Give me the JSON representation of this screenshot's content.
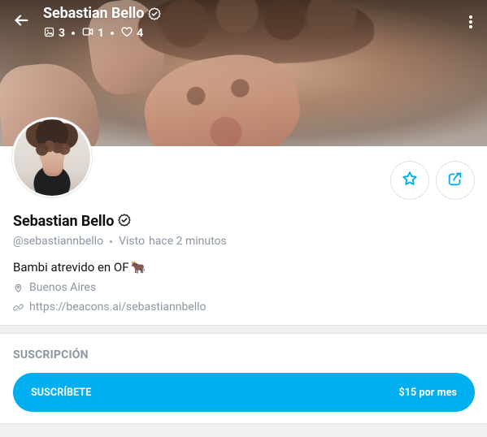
{
  "header": {
    "name": "Sebastian Bello",
    "stats": {
      "photos": "3",
      "videos": "1",
      "likes": "4"
    }
  },
  "profile": {
    "name": "Sebastian Bello",
    "username": "@sebastiannbello",
    "last_seen_label": "Visto",
    "last_seen_time": "hace 2 minutos",
    "bio": "Bambi atrevido en OF",
    "bio_emoji": "🐂",
    "location": "Buenos Aires",
    "website": "https://beacons.ai/sebastiannbello"
  },
  "subscription": {
    "title": "SUSCRIPCIÓN",
    "button_label": "SUSCRÍBETE",
    "price": "$15 por mes"
  },
  "icons": {
    "back": "back-arrow-icon",
    "verified": "verified-icon",
    "photo": "photo-icon",
    "video": "video-icon",
    "like": "heart-icon",
    "more": "more-vertical-icon",
    "favorite": "star-icon",
    "share": "share-icon",
    "location": "location-pin-icon",
    "website": "link-icon"
  },
  "colors": {
    "accent": "#00aff0",
    "text_primary": "#111111",
    "text_secondary": "#8a96a3",
    "background": "#f0f0f2",
    "card": "#ffffff"
  }
}
